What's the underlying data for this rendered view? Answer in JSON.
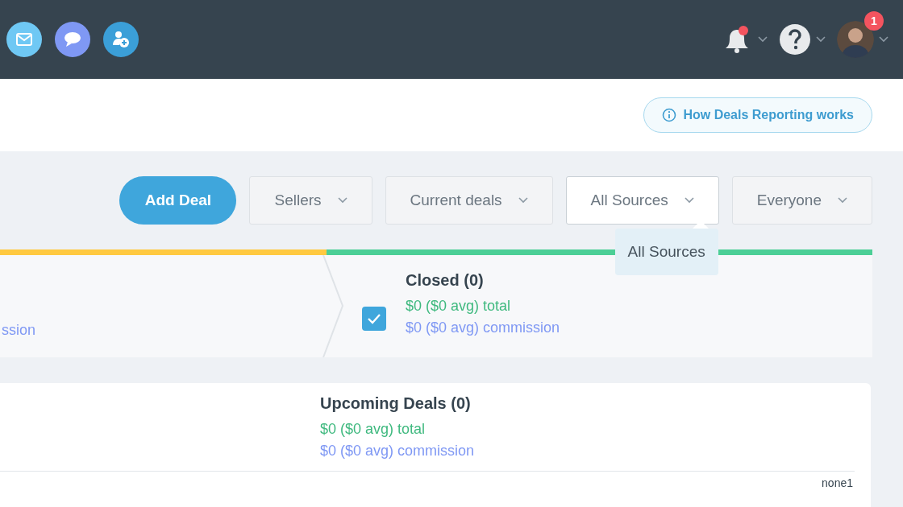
{
  "top_bar": {
    "quick_actions": [
      {
        "kind": "mail",
        "color": "#6fc8f4"
      },
      {
        "kind": "chat",
        "color": "#7f98f4"
      },
      {
        "kind": "add-user",
        "color": "#3b9fd8"
      }
    ],
    "avatar_badge": "1"
  },
  "help_link": {
    "label": "How Deals Reporting works"
  },
  "filters": {
    "add_button": "Add Deal",
    "dropdowns": [
      {
        "label": "Sellers",
        "open": false
      },
      {
        "label": "Current deals",
        "open": false
      },
      {
        "label": "All Sources",
        "open": true,
        "options": [
          "All Sources"
        ]
      },
      {
        "label": "Everyone",
        "open": false
      }
    ]
  },
  "stages": [
    {
      "kind": "partial",
      "color": "#ffc940",
      "commission": "ssion"
    },
    {
      "kind": "full",
      "color": "#4ccf96",
      "checked": true,
      "title": "Closed (0)",
      "total": "$0 ($0 avg) total",
      "commission": "$0 ($0 avg) commission"
    }
  ],
  "upcoming": {
    "title": "Upcoming Deals (0)",
    "total": "$0 ($0 avg) total",
    "commission": "$0 ($0 avg) commission",
    "footer": "none1"
  }
}
